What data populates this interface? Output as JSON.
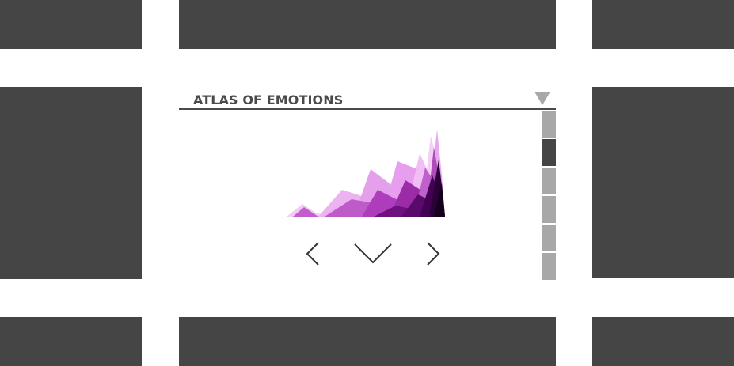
{
  "panel": {
    "title": "ATLAS OF EMOTIONS",
    "active_tab_index": 1,
    "tab_count": 6
  },
  "icons": {
    "dropdown": "triangle-down-icon",
    "prev": "chevron-left-icon",
    "down": "chevron-down-icon",
    "next": "chevron-right-icon"
  },
  "colors": {
    "tile": "#454545",
    "tab_inactive": "#a8a8a8",
    "tab_active": "#454545",
    "header_text": "#4a4a4a",
    "chart_light": "#e8a6ee",
    "chart_mid": "#b43cc0",
    "chart_dark": "#4a0050"
  }
}
